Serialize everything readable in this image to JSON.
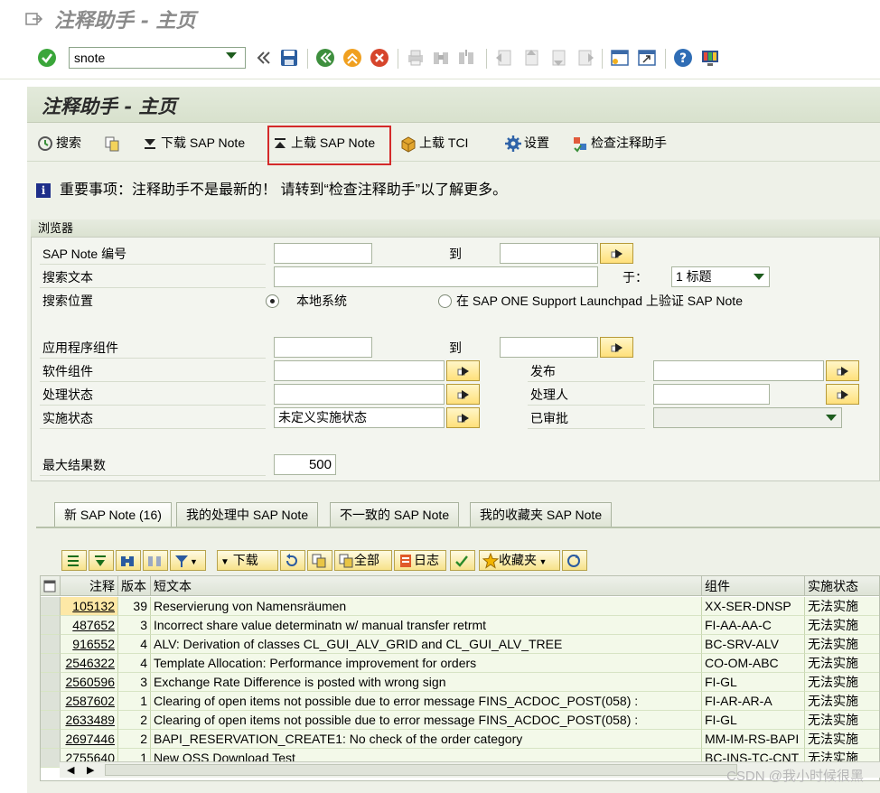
{
  "window": {
    "title": "注释助手 - 主页"
  },
  "toolbar": {
    "command_value": "snote",
    "icons": [
      "enter-check-icon",
      "save-icon",
      "back-icon",
      "exit-icon",
      "cancel-icon",
      "print-icon",
      "find-icon",
      "find-next-icon",
      "first-page-icon",
      "prev-page-icon",
      "next-page-icon",
      "last-page-icon",
      "new-session-icon",
      "shortcut-icon",
      "help-icon",
      "customize-icon"
    ]
  },
  "page": {
    "title": "注释助手 - 主页"
  },
  "app_toolbar": {
    "search": "搜索",
    "download": "下载 SAP Note",
    "upload": "上载 SAP Note",
    "upload_tci": "上载 TCI",
    "settings": "设置",
    "check_assistant": "检查注释助手"
  },
  "message": {
    "text": "重要事项：注释助手不是最新的！ 请转到“检查注释助手”以了解更多。"
  },
  "browser": {
    "group_title": "浏览器",
    "note_number_label": "SAP Note 编号",
    "to_label_1": "到",
    "search_text_label": "搜索文本",
    "in_label": "于：",
    "in_value": "1 标题",
    "search_location_label": "搜索位置",
    "radio_local": "本地系统",
    "radio_launchpad": "在 SAP ONE Support Launchpad 上验证 SAP Note",
    "app_component_label": "应用程序组件",
    "to_label_2": "到",
    "software_component_label": "软件组件",
    "release_label": "发布",
    "processing_status_label": "处理状态",
    "processor_label": "处理人",
    "implementation_status_label": "实施状态",
    "implementation_status_value": "未定义实施状态",
    "approved_label": "已审批",
    "max_results_label": "最大结果数",
    "max_results_value": "500"
  },
  "tabs": [
    {
      "label": "新 SAP Note (16)"
    },
    {
      "label": "我的处理中 SAP Note"
    },
    {
      "label": "不一致的 SAP Note"
    },
    {
      "label": "我的收藏夹 SAP Note"
    }
  ],
  "alv_toolbar": {
    "download": "下载",
    "all": "全部",
    "log": "日志",
    "favorites": "收藏夹"
  },
  "grid": {
    "headers": [
      "注释",
      "版本",
      "短文本",
      "组件",
      "实施状态"
    ],
    "rows": [
      {
        "note": "105132",
        "version": "39",
        "text": "Reservierung von Namensräumen",
        "component": "XX-SER-DNSP",
        "status": "无法实施"
      },
      {
        "note": "487652",
        "version": "3",
        "text": "Incorrect share value determinatn w/ manual transfer retrmt",
        "component": "FI-AA-AA-C",
        "status": "无法实施"
      },
      {
        "note": "916552",
        "version": "4",
        "text": "ALV: Derivation of classes CL_GUI_ALV_GRID and CL_GUI_ALV_TREE",
        "component": "BC-SRV-ALV",
        "status": "无法实施"
      },
      {
        "note": "2546322",
        "version": "4",
        "text": "Template Allocation: Performance improvement for orders",
        "component": "CO-OM-ABC",
        "status": "无法实施"
      },
      {
        "note": "2560596",
        "version": "3",
        "text": "Exchange Rate Difference is posted with wrong sign",
        "component": "FI-GL",
        "status": "无法实施"
      },
      {
        "note": "2587602",
        "version": "1",
        "text": "Clearing of open items not possible due to error message FINS_ACDOC_POST(058) :",
        "component": "FI-AR-AR-A",
        "status": "无法实施"
      },
      {
        "note": "2633489",
        "version": "2",
        "text": "Clearing of open items not possible due to error message FINS_ACDOC_POST(058) :",
        "component": "FI-GL",
        "status": "无法实施"
      },
      {
        "note": "2697446",
        "version": "2",
        "text": "BAPI_RESERVATION_CREATE1: No check of the order category",
        "component": "MM-IM-RS-BAPI",
        "status": "无法实施"
      },
      {
        "note": "2755640",
        "version": "1",
        "text": "New OSS Download Test",
        "component": "BC-INS-TC-CNT",
        "status": "无法实施"
      }
    ]
  },
  "watermark": "CSDN @我小时候很黑",
  "colors": {
    "page_bg": "#eef1e8",
    "highlight_box": "#d42a2a",
    "grid_row": "#f3f9e9",
    "selected_cell": "#fde8a6"
  }
}
